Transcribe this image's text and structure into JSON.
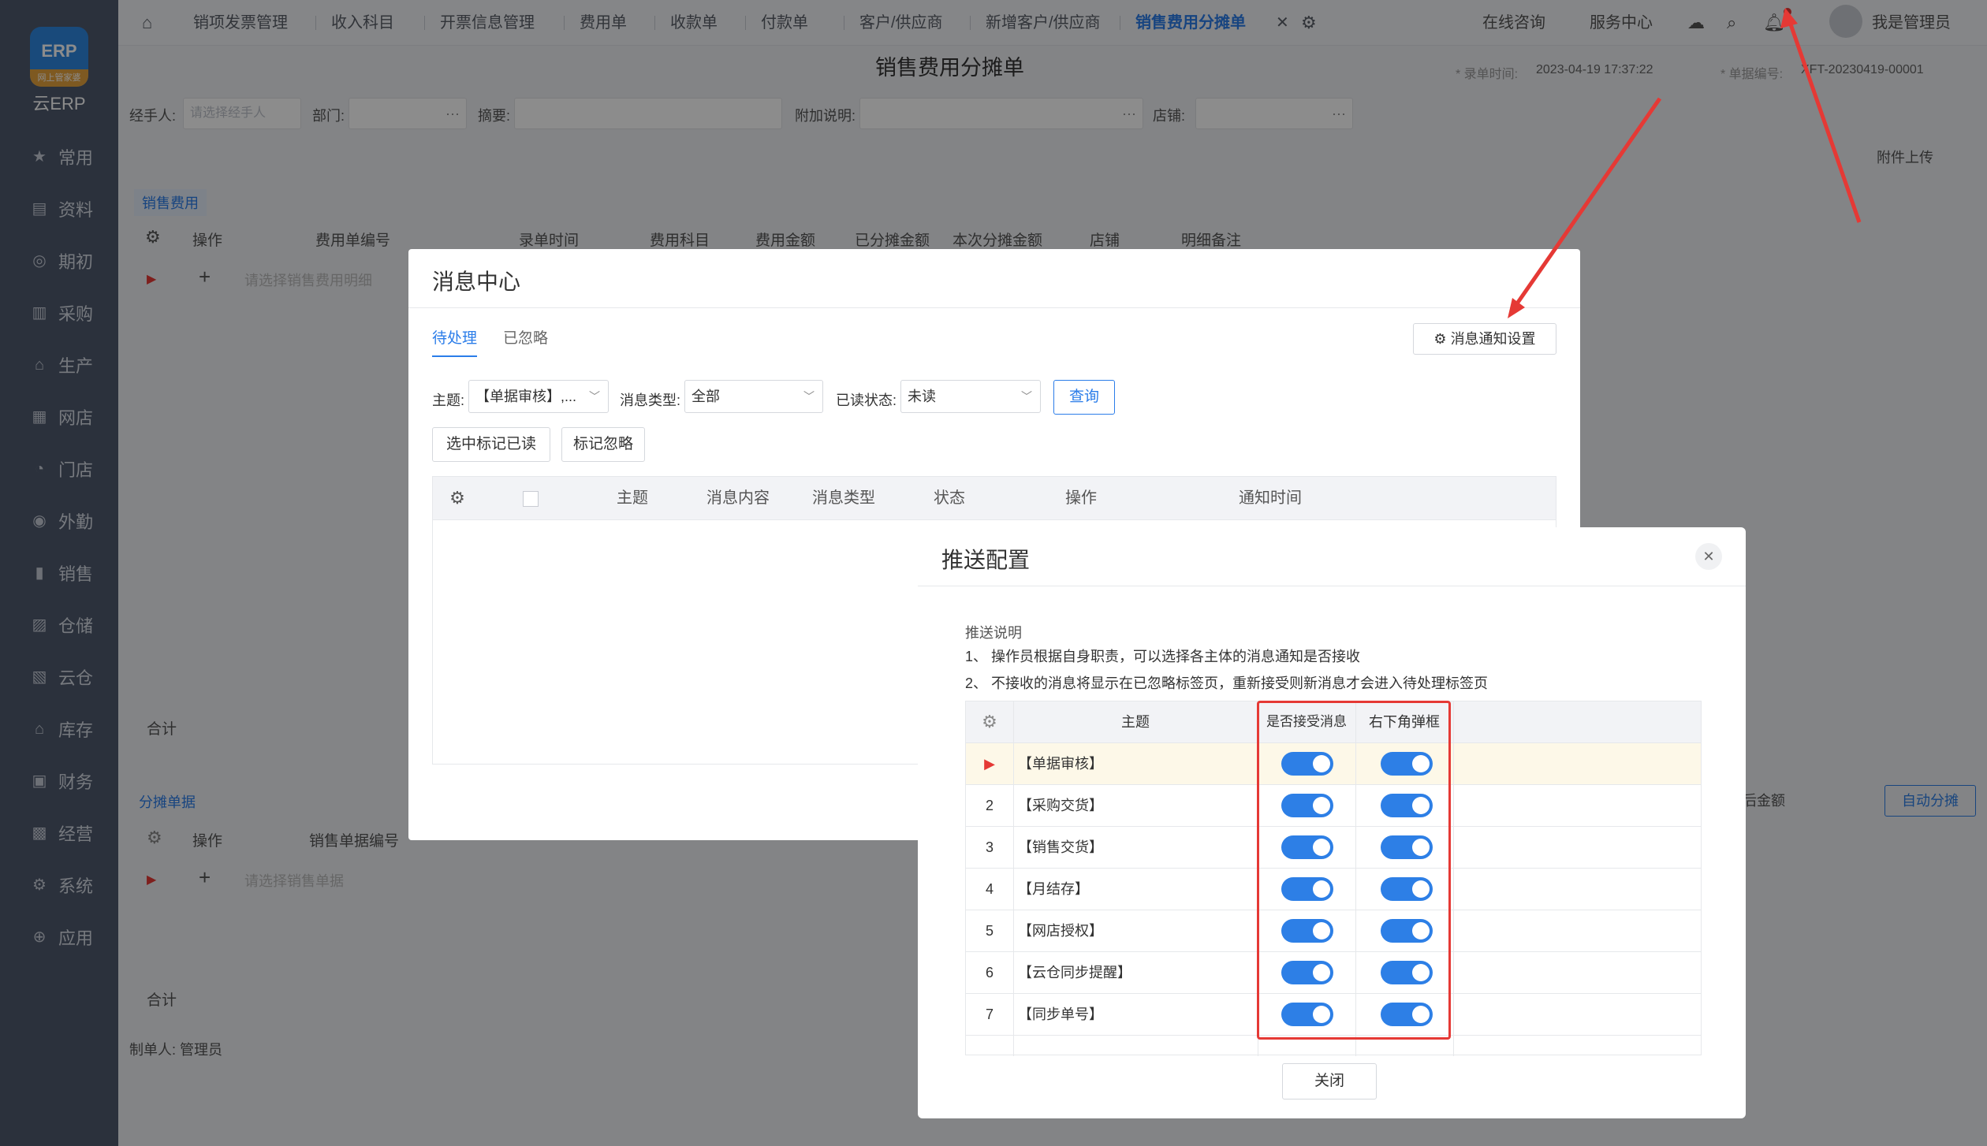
{
  "sidebar": {
    "logo_text": "ERP",
    "logo_badge": "网上管家婆",
    "brand": "云ERP",
    "items": [
      {
        "label": "常用",
        "icon": "star-icon"
      },
      {
        "label": "资料",
        "icon": "file-icon"
      },
      {
        "label": "期初",
        "icon": "clock-icon"
      },
      {
        "label": "采购",
        "icon": "cart-icon"
      },
      {
        "label": "生产",
        "icon": "factory-icon"
      },
      {
        "label": "网店",
        "icon": "shop-icon"
      },
      {
        "label": "门店",
        "icon": "store-icon"
      },
      {
        "label": "外勤",
        "icon": "location-icon"
      },
      {
        "label": "销售",
        "icon": "chart-icon"
      },
      {
        "label": "仓储",
        "icon": "warehouse-icon"
      },
      {
        "label": "云仓",
        "icon": "cloud-warehouse-icon"
      },
      {
        "label": "库存",
        "icon": "inventory-icon"
      },
      {
        "label": "财务",
        "icon": "finance-icon"
      },
      {
        "label": "经营",
        "icon": "business-icon"
      },
      {
        "label": "系统",
        "icon": "settings-icon"
      },
      {
        "label": "应用",
        "icon": "plus-icon"
      }
    ]
  },
  "topbar": {
    "tabs": [
      "销项发票管理",
      "收入科目",
      "开票信息管理",
      "费用单",
      "收款单",
      "付款单",
      "客户/供应商",
      "新增客户/供应商",
      "销售费用分摊单"
    ],
    "online": "在线咨询",
    "service": "服务中心",
    "user": "我是管理员"
  },
  "bg": {
    "title": "销售费用分摊单",
    "record_time_label": "* 录单时间:",
    "record_time": "2023-04-19 17:37:22",
    "doc_no_label": "* 单据编号:",
    "doc_no": "XFT-20230419-00001",
    "handler_label": "经手人:",
    "handler_placeholder": "请选择经手人",
    "dept_label": "部门:",
    "summary_label": "摘要:",
    "note_label": "附加说明:",
    "store_label": "店铺:",
    "attach": "附件上传",
    "sec1": "销售费用",
    "cols1": [
      "操作",
      "费用单编号",
      "录单时间",
      "费用科目",
      "费用金额",
      "已分摊金额",
      "本次分摊金额",
      "店铺",
      "明细备注"
    ],
    "row1_placeholder": "请选择销售费用明细",
    "total": "合计",
    "sec2": "分摊单据",
    "cols2": [
      "操作",
      "销售单据编号"
    ],
    "row2_placeholder": "请选择销售单据",
    "after_amount": "后金额",
    "auto_btn": "自动分摊",
    "maker": "制单人: 管理员"
  },
  "msg": {
    "title": "消息中心",
    "tabs": [
      "待处理",
      "已忽略"
    ],
    "settings_btn": "消息通知设置",
    "subject_label": "主题:",
    "subject_value": "【单据审核】,...",
    "type_label": "消息类型:",
    "type_value": "全部",
    "read_label": "已读状态:",
    "read_value": "未读",
    "query_btn": "查询",
    "mark_read_btn": "选中标记已读",
    "ignore_btn": "标记忽略",
    "columns": [
      "主题",
      "消息内容",
      "消息类型",
      "状态",
      "操作",
      "通知时间"
    ]
  },
  "push": {
    "title": "推送配置",
    "note_title": "推送说明",
    "note1": "1、 操作员根据自身职责，可以选择各主体的消息通知是否接收",
    "note2": "2、 不接收的消息将显示在已忽略标签页，重新接受则新消息才会进入待处理标签页",
    "col_subject": "主题",
    "col_receive": "是否接受消息",
    "col_popup": "右下角弹框",
    "rows": [
      {
        "no": "",
        "subject": "【单据审核】",
        "receive": true,
        "popup": true
      },
      {
        "no": "2",
        "subject": "【采购交货】",
        "receive": true,
        "popup": true
      },
      {
        "no": "3",
        "subject": "【销售交货】",
        "receive": true,
        "popup": true
      },
      {
        "no": "4",
        "subject": "【月结存】",
        "receive": true,
        "popup": true
      },
      {
        "no": "5",
        "subject": "【网店授权】",
        "receive": true,
        "popup": true
      },
      {
        "no": "6",
        "subject": "【云仓同步提醒】",
        "receive": true,
        "popup": true
      },
      {
        "no": "7",
        "subject": "【同步单号】",
        "receive": true,
        "popup": true
      }
    ],
    "close_btn": "关闭"
  },
  "colors": {
    "accent": "#2d7fe6",
    "sidebar": "#4f5a6e",
    "highlight": "#e53935"
  }
}
